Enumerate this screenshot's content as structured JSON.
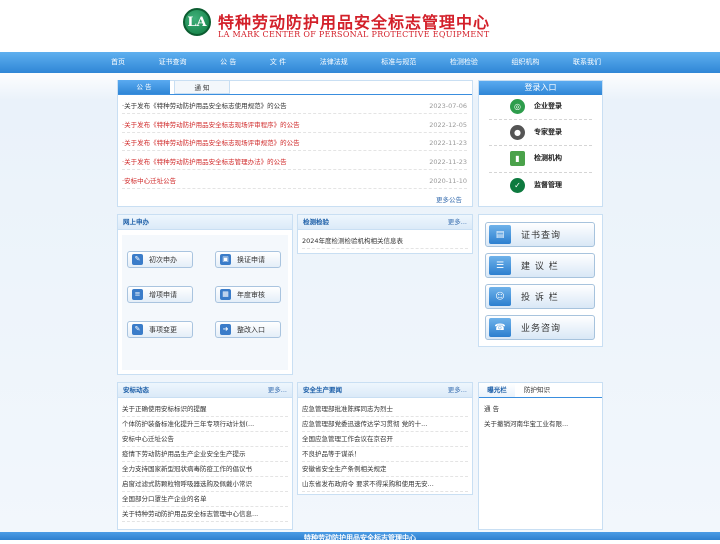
{
  "header": {
    "logo_text": "LA",
    "title": "特种劳动防护用品安全标志管理中心",
    "subtitle": "LA MARK CENTER OF PERSONAL PROTECTIVE EQUIPMENT"
  },
  "nav": [
    "首页",
    "证书查询",
    "公 告",
    "文 件",
    "法律法规",
    "标准与规范",
    "检测检验",
    "组织机构",
    "联系我们"
  ],
  "notice": {
    "tab_active": "公 告",
    "tab_inactive": "通 知",
    "more": "更多公告",
    "items": [
      {
        "text": "·关于发布《特种劳动防护用品安全标志使用规范》的公告",
        "date": "2023-07-06",
        "red": false
      },
      {
        "text": "·关于发布《特种劳动防护用品安全标志现场评审程序》的公告",
        "date": "2022-12-05",
        "red": true
      },
      {
        "text": "·关于发布《特种劳动防护用品安全标志现场评审规范》的公告",
        "date": "2022-11-23",
        "red": true
      },
      {
        "text": "·关于发布《特种劳动防护用品安全标志管理办法》的公告",
        "date": "2022-11-23",
        "red": true
      },
      {
        "text": "·安标中心迁址公告",
        "date": "2020-11-10",
        "red": true
      }
    ]
  },
  "login": {
    "title": "登录入口",
    "items": [
      "企业登录",
      "专家登录",
      "检测机构",
      "监督管理"
    ]
  },
  "online": {
    "title": "网上申办",
    "buttons": [
      "初次申办",
      "换证申请",
      "增项申请",
      "年度审核",
      "事项变更",
      "整改入口"
    ]
  },
  "testing": {
    "title": "检测检验",
    "more": "更多...",
    "items": [
      "2024年度检测检验机构相关信息表"
    ]
  },
  "side_buttons": [
    "证书查询",
    "建 议 栏",
    "投 诉 栏",
    "业务咨询"
  ],
  "news": {
    "title": "安标动态",
    "more": "更多...",
    "items": [
      "关于正确使用安标标识的提醒",
      "个体防护装备标准化提升三年专项行动计划(...",
      "安标中心迁址公告",
      "疫情下劳动防护用品生产企业安全生产提示",
      "全力支持国家新型冠状病毒防疫工作的倡议书",
      "启窗过滤式防颗粒物呼吸器选购及佩戴小常识",
      "全国部分口罩生产企业的名单",
      "关于特种劳动防护用品安全标志管理中心信息..."
    ]
  },
  "safety": {
    "title": "安全生产要闻",
    "more": "更多...",
    "items": [
      "应急管理部批准陈辉同志为烈士",
      "应急管理部党委迅速传达学习贯彻 党的十...",
      "全国应急管理工作会议在京召开",
      "不良护品等于谋杀！",
      "安徽省安全生产条例相关规定",
      "山东省发布政府令 要求不得采购和使用无安..."
    ]
  },
  "bulletin": {
    "tab_active": "曝光栏",
    "tab_inactive": "防护知识",
    "items": [
      "通 告",
      "关于撤销河南华宝工业有限..."
    ]
  },
  "footer": {
    "text": "特种劳动防护用品安全标志管理中心"
  }
}
